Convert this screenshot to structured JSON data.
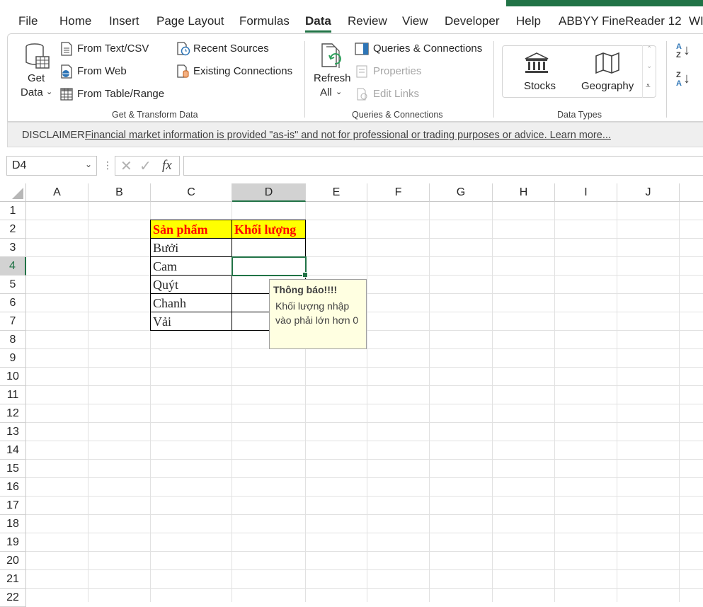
{
  "menu": {
    "tabs": [
      {
        "label": "File"
      },
      {
        "label": "Home"
      },
      {
        "label": "Insert"
      },
      {
        "label": "Page Layout"
      },
      {
        "label": "Formulas"
      },
      {
        "label": "Data"
      },
      {
        "label": "Review"
      },
      {
        "label": "View"
      },
      {
        "label": "Developer"
      },
      {
        "label": "Help"
      },
      {
        "label": "ABBYY FineReader 12"
      },
      {
        "label": "WI"
      }
    ],
    "active": "Data"
  },
  "ribbon": {
    "get_data": {
      "line1": "Get",
      "line2": "Data"
    },
    "from_text_csv": "From Text/CSV",
    "from_web": "From Web",
    "from_table_range": "From Table/Range",
    "recent_sources": "Recent Sources",
    "existing_connections": "Existing Connections",
    "group_get_transform": "Get & Transform Data",
    "refresh_all": {
      "line1": "Refresh",
      "line2": "All"
    },
    "queries_connections": "Queries & Connections",
    "properties": "Properties",
    "edit_links": "Edit Links",
    "group_queries": "Queries & Connections",
    "stocks": "Stocks",
    "geography": "Geography",
    "group_data_types": "Data Types",
    "sort_az": {
      "line1": "A",
      "line2": "Z"
    },
    "sort_za": {
      "line1": "Z",
      "line2": "A"
    }
  },
  "disclaimer": {
    "label": "DISCLAIMER",
    "message": "Financial market information is provided \"as-is\" and not for professional or trading purposes or advice. Learn more..."
  },
  "formula_bar": {
    "name_box": "D4",
    "fx_label": "fx",
    "formula": ""
  },
  "sheet": {
    "columns": [
      "A",
      "B",
      "C",
      "D",
      "E",
      "F",
      "G",
      "H",
      "I",
      "J"
    ],
    "rows": [
      "1",
      "2",
      "3",
      "4",
      "5",
      "6",
      "7",
      "8",
      "9",
      "10",
      "11",
      "12",
      "13",
      "14",
      "15",
      "16",
      "17",
      "18",
      "19",
      "20",
      "21",
      "22"
    ],
    "selected_cell": "D4",
    "table": {
      "header": [
        "Sản phẩm",
        "Khối lượng"
      ],
      "items": [
        "Bưởi",
        "Cam",
        "Quýt",
        "Chanh",
        "Vải"
      ]
    },
    "header_bg": "#ffff00",
    "header_color": "#ff0000",
    "accent": "#217346"
  },
  "input_message": {
    "title": "Thông báo!!!!",
    "body": "Khối lượng nhập vào phải lớn hơn 0"
  }
}
